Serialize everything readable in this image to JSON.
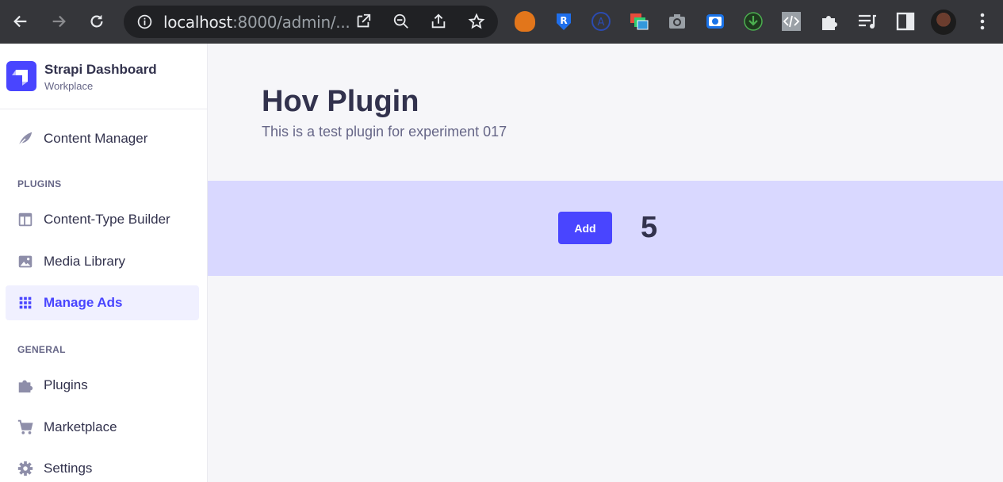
{
  "browser": {
    "url_host": "localhost",
    "url_rest": ":8000/admin/...",
    "extensions": [
      "fox-icon",
      "r-shield-icon",
      "a-circle-icon",
      "windows-icon",
      "camera-icon",
      "record-icon",
      "download-icon",
      "code-icon",
      "puzzle-icon",
      "playlist-icon",
      "sidepanel-icon",
      "avatar",
      "menu-icon"
    ]
  },
  "sidebar": {
    "brand_title": "Strapi Dashboard",
    "brand_sub": "Workplace",
    "content_manager": "Content Manager",
    "section_plugins": "PLUGINS",
    "plugins_items": [
      {
        "label": "Content-Type Builder",
        "icon": "layout-icon"
      },
      {
        "label": "Media Library",
        "icon": "image-icon"
      },
      {
        "label": "Manage Ads",
        "icon": "grid-icon",
        "active": true
      }
    ],
    "section_general": "GENERAL",
    "general_items": [
      {
        "label": "Plugins",
        "icon": "puzzle-icon"
      },
      {
        "label": "Marketplace",
        "icon": "cart-icon"
      },
      {
        "label": "Settings",
        "icon": "gear-icon"
      }
    ]
  },
  "main": {
    "title": "Hov Plugin",
    "subtitle": "This is a test plugin for experiment 017",
    "add_label": "Add",
    "count": "5"
  },
  "colors": {
    "accent": "#4945ff",
    "band": "#d9d8ff",
    "chrome": "#35363a"
  }
}
